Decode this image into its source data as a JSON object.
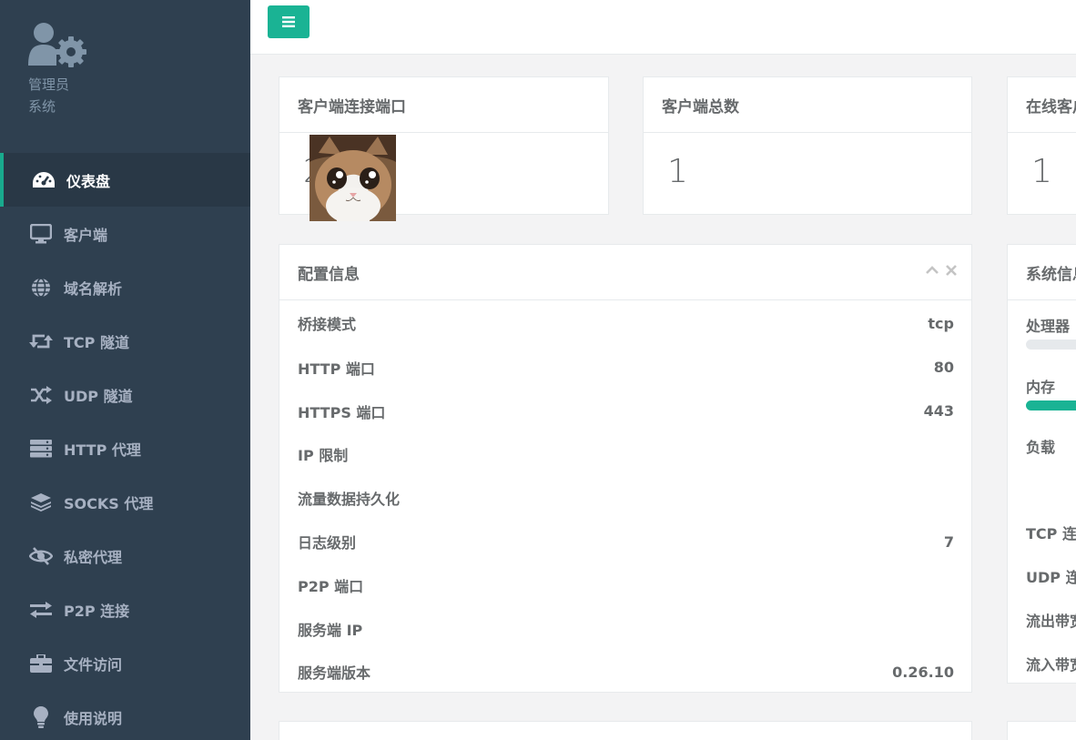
{
  "sidebar": {
    "profile": {
      "name": "管理员",
      "role": "系统"
    },
    "items": [
      {
        "label": "仪表盘",
        "icon": "dashboard-icon",
        "active": true
      },
      {
        "label": "客户端",
        "icon": "desktop-icon"
      },
      {
        "label": "域名解析",
        "icon": "globe-icon"
      },
      {
        "label": "TCP 隧道",
        "icon": "retweet-icon"
      },
      {
        "label": "UDP 隧道",
        "icon": "random-icon"
      },
      {
        "label": "HTTP 代理",
        "icon": "server-icon"
      },
      {
        "label": "SOCKS 代理",
        "icon": "layers-icon"
      },
      {
        "label": "私密代理",
        "icon": "eye-slash-icon"
      },
      {
        "label": "P2P 连接",
        "icon": "exchange-icon"
      },
      {
        "label": "文件访问",
        "icon": "briefcase-icon"
      },
      {
        "label": "使用说明",
        "icon": "lightbulb-icon"
      }
    ]
  },
  "topbar": {
    "menu_icon": "bars-icon"
  },
  "cards": {
    "client_port": {
      "title": "客户端连接端口",
      "value": "2"
    },
    "client_total": {
      "title": "客户端总数",
      "value": "1"
    },
    "online_clients": {
      "title": "在线客户",
      "value": "1"
    }
  },
  "config": {
    "title": "配置信息",
    "rows": [
      {
        "label": "桥接模式",
        "value": "tcp"
      },
      {
        "label": "HTTP 端口",
        "value": "80"
      },
      {
        "label": "HTTPS 端口",
        "value": "443"
      },
      {
        "label": "IP 限制",
        "value": ""
      },
      {
        "label": "流量数据持久化",
        "value": ""
      },
      {
        "label": "日志级别",
        "value": "7"
      },
      {
        "label": "P2P 端口",
        "value": ""
      },
      {
        "label": "服务端 IP",
        "value": ""
      },
      {
        "label": "服务端版本",
        "value": "0.26.10"
      }
    ]
  },
  "system": {
    "title": "系统信息",
    "cpu_label": "处理器",
    "cpu_usage": 0,
    "mem_label": "内存",
    "mem_usage": 1,
    "load_label": "负载",
    "tcp_label": "TCP 连接",
    "udp_label": "UDP 连接",
    "out_label": "流出带宽",
    "in_label": "流入带宽"
  },
  "colors": {
    "sidebar": "#2f4050",
    "sidebar_active": "#293846",
    "accent": "#1ab394"
  }
}
